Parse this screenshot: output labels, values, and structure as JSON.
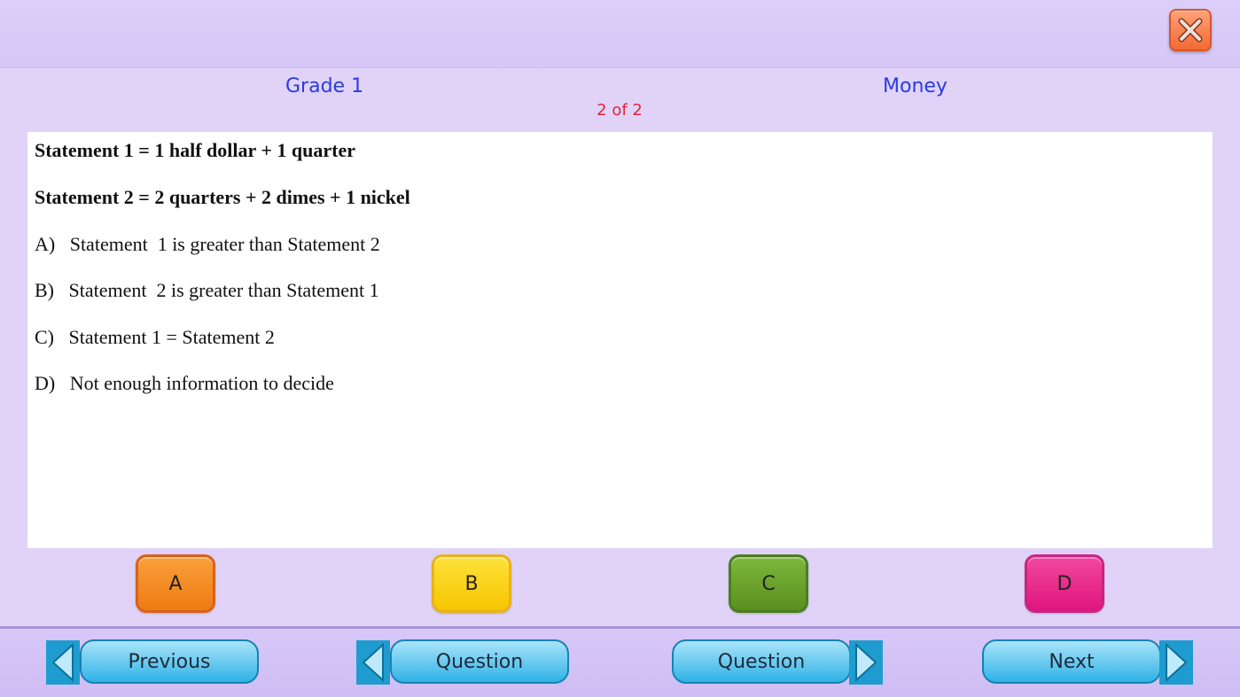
{
  "header": {
    "grade": "Grade 1",
    "topic": "Money",
    "counter": "2 of 2"
  },
  "question": {
    "statement1": "Statement 1 = 1 half dollar + 1 quarter",
    "statement2": "Statement 2 = 2 quarters + 2 dimes + 1 nickel",
    "options": [
      "A)   Statement  1 is greater than Statement 2",
      "B)   Statement  2 is greater than Statement 1",
      "C)   Statement 1 = Statement 2",
      "D)   Not enough information to decide"
    ]
  },
  "answers": {
    "a": "A",
    "b": "B",
    "c": "C",
    "d": "D"
  },
  "nav": {
    "previous": "Previous",
    "question_prev": "Question",
    "question_next": "Question",
    "next": "Next"
  },
  "colors": {
    "background": "#e0d3f7",
    "header_text": "#2a3be0",
    "counter_text": "#e6233e",
    "answer_a": "#f07b14",
    "answer_b": "#f6c500",
    "answer_c": "#5a8f1f",
    "answer_d": "#e0157d",
    "nav_button": "#2fb2e6"
  },
  "icons": {
    "close": "close-icon",
    "left": "arrow-left-icon",
    "right": "arrow-right-icon"
  }
}
